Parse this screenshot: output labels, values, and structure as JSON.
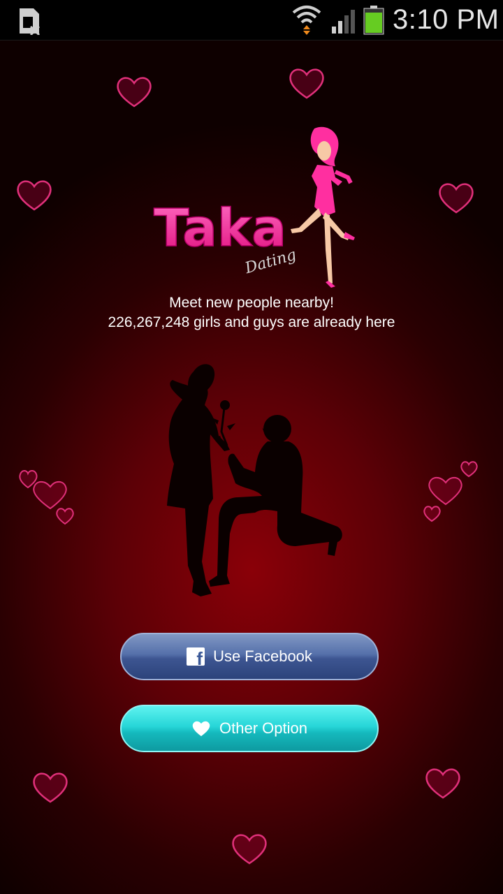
{
  "status_bar": {
    "time": "3:10 PM",
    "icons": [
      "sim-error-icon",
      "wifi-icon",
      "signal-icon",
      "battery-icon"
    ],
    "battery_color": "#66cc22"
  },
  "app": {
    "logo_text": "Taka",
    "logo_subtext": "Dating",
    "tagline_line1": "Meet new people nearby!",
    "tagline_line2": "226,267,248 girls and guys are already here"
  },
  "buttons": {
    "facebook_label": "Use Facebook",
    "facebook_icon": "facebook-icon",
    "other_label": "Other Option",
    "other_icon": "heart-icon"
  },
  "colors": {
    "logo_pink": "#ff2fa0",
    "heart_pink": "#ff3d9a",
    "facebook_blue": "#3d5591",
    "other_teal": "#1fcfd1"
  }
}
